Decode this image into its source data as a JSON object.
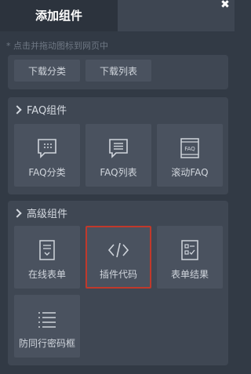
{
  "header": {
    "active_tab_label": "添加组件"
  },
  "hint": "* 点击并拖动图标到网页中",
  "top_partial": {
    "items": [
      {
        "label": "下载分类",
        "icon": "download-category-icon"
      },
      {
        "label": "下载列表",
        "icon": "download-list-icon"
      }
    ]
  },
  "faq_panel": {
    "title": "FAQ组件",
    "items": [
      {
        "label": "FAQ分类",
        "icon": "faq-category-icon"
      },
      {
        "label": "FAQ列表",
        "icon": "faq-list-icon"
      },
      {
        "label": "滚动FAQ",
        "icon": "scroll-faq-icon",
        "icon_text": "FAQ"
      }
    ]
  },
  "advanced_panel": {
    "title": "高级组件",
    "items": [
      {
        "label": "在线表单",
        "icon": "online-form-icon"
      },
      {
        "label": "插件代码",
        "icon": "plugin-code-icon",
        "selected": true
      },
      {
        "label": "表单结果",
        "icon": "form-result-icon"
      },
      {
        "label": "防同行密码框",
        "icon": "password-box-icon"
      }
    ]
  },
  "colors": {
    "background": "#323a45",
    "panel": "#3f4753",
    "tile": "#4a525f",
    "selected_border": "#c0392b"
  }
}
